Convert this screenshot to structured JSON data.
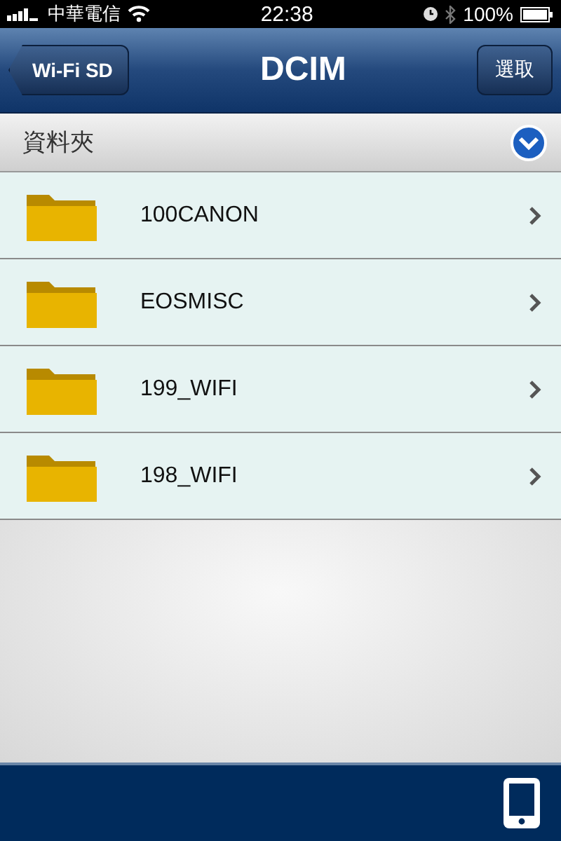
{
  "status_bar": {
    "carrier": "中華電信",
    "time": "22:38",
    "battery": "100%"
  },
  "nav": {
    "back": "Wi-Fi SD",
    "title": "DCIM",
    "action": "選取"
  },
  "section": {
    "title": "資料夾"
  },
  "folders": [
    {
      "name": "100CANON"
    },
    {
      "name": "EOSMISC"
    },
    {
      "name": "199_WIFI"
    },
    {
      "name": "198_WIFI"
    }
  ]
}
